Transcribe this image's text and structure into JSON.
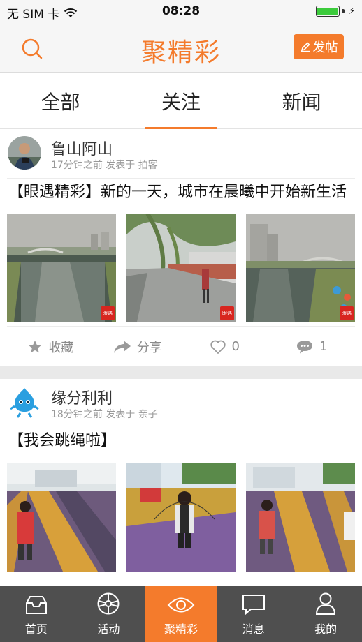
{
  "status_bar": {
    "carrier": "无 SIM 卡",
    "time": "08:28"
  },
  "header": {
    "title": "聚精彩",
    "post_button": "发帖"
  },
  "tabs": [
    {
      "label": "全部"
    },
    {
      "label": "关注"
    },
    {
      "label": "新闻"
    }
  ],
  "posts": [
    {
      "author": "鲁山阿山",
      "meta": "17分钟之前 发表于 拍客",
      "text": "【眼遇精彩】新的一天，城市在晨曦中开始新生活",
      "photo_tag": "眼遇",
      "actions": {
        "favorite": "收藏",
        "share": "分享",
        "likes": "0",
        "comments": "1"
      }
    },
    {
      "author": "缘分利利",
      "meta": "18分钟之前 发表于 亲子",
      "text": "【我会跳绳啦】"
    }
  ],
  "bottom_nav": [
    {
      "label": "首页",
      "icon": "inbox-icon"
    },
    {
      "label": "活动",
      "icon": "wheel-icon"
    },
    {
      "label": "聚精彩",
      "icon": "eye-icon"
    },
    {
      "label": "消息",
      "icon": "chat-icon"
    },
    {
      "label": "我的",
      "icon": "person-icon"
    }
  ],
  "colors": {
    "accent": "#f47b2c",
    "tabbar": "#4f4f4f"
  }
}
